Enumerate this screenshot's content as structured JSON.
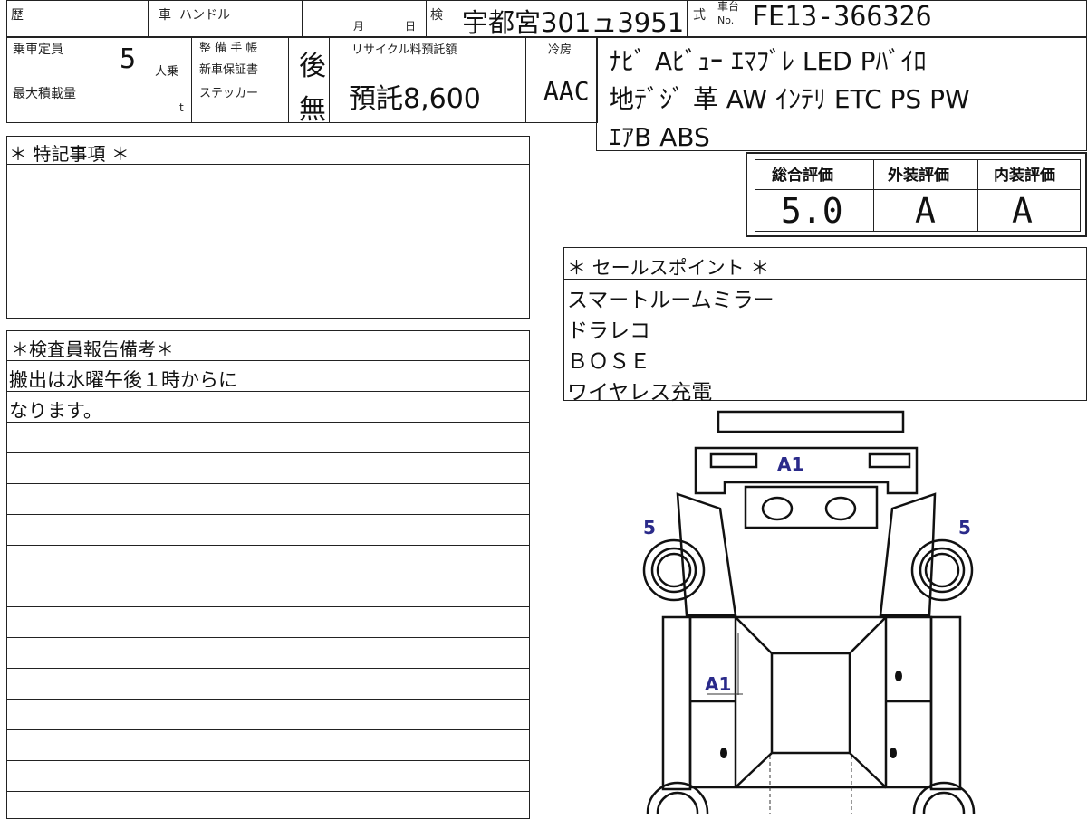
{
  "header": {
    "history_label": "歴",
    "car_label": "車",
    "handle_label": "ハンドル",
    "month_label": "月",
    "day_label": "日",
    "inspection_label": "検",
    "plate": "宇都宮301ュ3951",
    "type_label": "式",
    "chassis_label_top": "車台",
    "chassis_label_bottom": "No.",
    "chassis_no": "FE13-366326"
  },
  "row2": {
    "capacity_label": "乗車定員",
    "capacity_value": "5",
    "capacity_unit": "人乗",
    "maintenance_label": "整 備 手 帳",
    "warranty_label": "新車保証書",
    "maintenance_value": "後",
    "max_load_label": "最大積載量",
    "max_load_unit": "t",
    "sticker_label": "ステッカー",
    "sticker_value": "無",
    "recycle_label": "リサイクル料預託額",
    "recycle_value": "預託8,600",
    "aircon_label": "冷房",
    "aircon_value": "AAC"
  },
  "equipment": [
    "ﾅﾋﾞ Aﾋﾞｭｰ ｴﾏﾌﾞﾚ LED Pﾊﾞｲﾛ",
    "地ﾃﾞｼﾞ 革 AW ｲﾝﾃﾘ ETC PS PW",
    "ｴｱB ABS"
  ],
  "ratings": {
    "overall_label": "総合評価",
    "exterior_label": "外装評価",
    "interior_label": "内装評価",
    "overall_value": "5.0",
    "exterior_value": "A",
    "interior_value": "A"
  },
  "special_notes": {
    "title": "＊ 特記事項 ＊"
  },
  "inspector_notes": {
    "title": "＊検査員報告備考＊",
    "lines": [
      "搬出は水曜午後１時からに",
      "なります。"
    ]
  },
  "sales_points": {
    "title": "＊ セールスポイント ＊",
    "items": [
      "スマートルームミラー",
      "ドラレコ",
      "ＢＯＳＥ",
      "ワイヤレス充電"
    ]
  },
  "diagram": {
    "marks": [
      "A1",
      "5",
      "5",
      "A1"
    ],
    "mark_color": "#2a2a8a"
  }
}
